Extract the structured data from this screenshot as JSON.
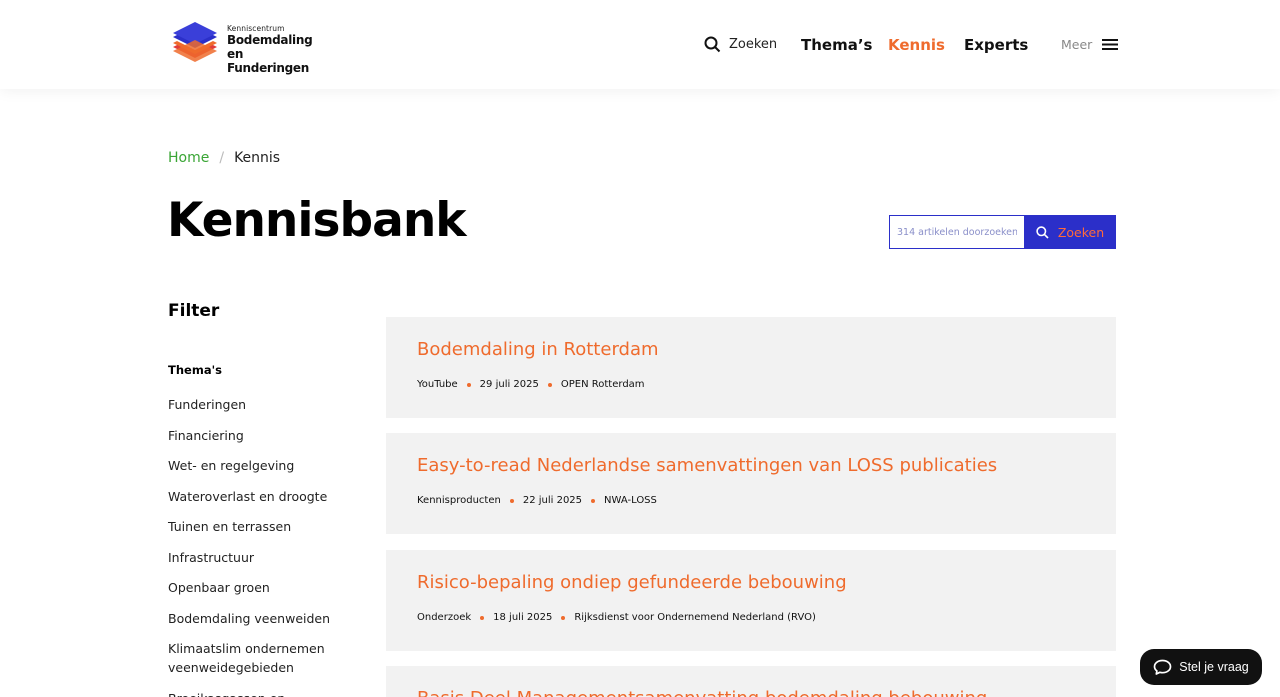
{
  "header": {
    "logo": {
      "small_text": "Kenniscentrum",
      "line1": "Bodemdaling",
      "line2": "en Funderingen",
      "colors": [
        "#2b2fc9",
        "#ef6b2d",
        "#e23b3b"
      ]
    },
    "nav": {
      "search_label": "Zoeken",
      "search_icon": "search-icon",
      "themas": "Thema’s",
      "kennis": "Kennis",
      "experts": "Experts",
      "meer": "Meer",
      "menu_icon": "hamburger-menu-icon"
    }
  },
  "breadcrumb": {
    "home": "Home",
    "separator": "/",
    "current": "Kennis"
  },
  "page": {
    "title": "Kennisbank"
  },
  "search": {
    "placeholder": "314 artikelen doorzoeken",
    "button_label": "Zoeken"
  },
  "filter": {
    "title": "Filter",
    "group_title": "Thema's",
    "items": [
      "Funderingen",
      "Financiering",
      "Wet- en regelgeving",
      "Wateroverlast en droogte",
      "Tuinen en terrassen",
      "Infrastructuur",
      "Openbaar groen",
      "Bodemdaling veenweiden",
      "Klimaatslim ondernemen veenweidegebieden",
      "Broeikasgassen en veenoxidatie"
    ]
  },
  "articles": [
    {
      "title": "Bodemdaling in Rotterdam",
      "type": "YouTube",
      "date": "29 juli 2025",
      "source": "OPEN Rotterdam"
    },
    {
      "title": "Easy-to-read Nederlandse samenvattingen van LOSS publicaties",
      "type": "Kennisproducten",
      "date": "22 juli 2025",
      "source": "NWA-LOSS"
    },
    {
      "title": "Risico-bepaling ondiep gefundeerde bebouwing",
      "type": "Onderzoek",
      "date": "18 juli 2025",
      "source": "Rijksdienst voor Ondernemend Nederland (RVO)"
    },
    {
      "title": "Basis Deel Managementsamenvatting bodemdaling bebouwing",
      "type": "",
      "date": "",
      "source": ""
    }
  ],
  "chat": {
    "label": "Stel je vraag",
    "icon": "chat-bubble-icon"
  },
  "colors": {
    "accent_orange": "#ef6b2d",
    "brand_blue": "#2b2fc9",
    "breadcrumb_green": "#3aa535",
    "card_bg": "#f2f2f2"
  }
}
